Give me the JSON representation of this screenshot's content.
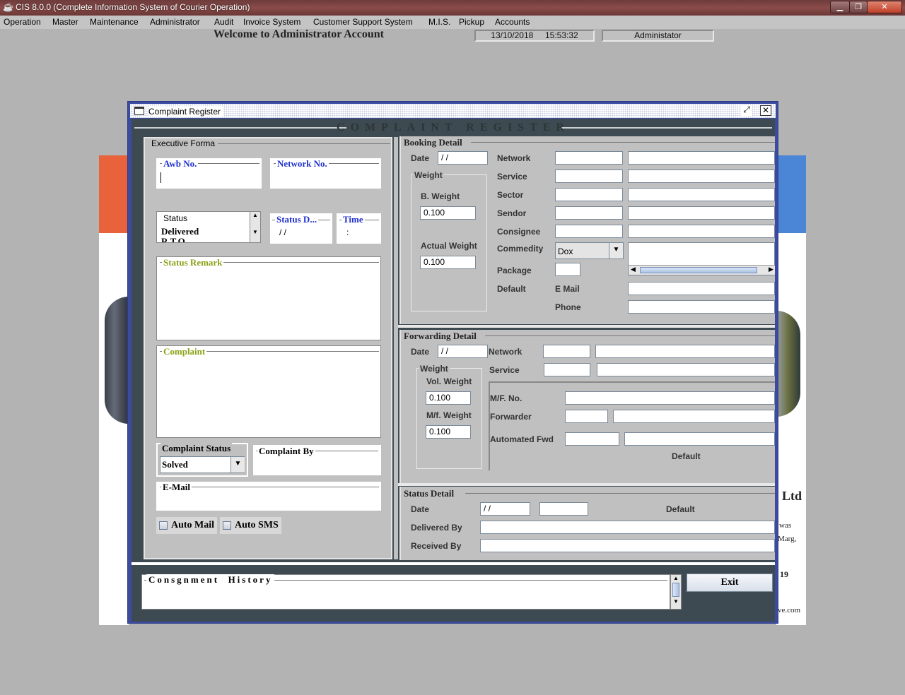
{
  "window": {
    "title": "CIS 8.0.0 (Complete Information System of Courier Operation)",
    "min_icon": "minimize-icon",
    "max_icon": "maximize-icon",
    "close_icon": "close-icon"
  },
  "menu": [
    "Operation",
    "Master",
    "Maintenance",
    "Administrator",
    "Audit",
    "Invoice System",
    "Customer Support System",
    "M.I.S.",
    "Pickup",
    "Accounts"
  ],
  "header": {
    "welcome": "Welcome to Administrator Account",
    "date": "13/10/2018",
    "time": "15:53:32",
    "user": "Administator"
  },
  "background": {
    "company_suffix": "Ltd",
    "addr1": "was",
    "addr2": "Marg,",
    "phone_frag": "19",
    "web_frag": "ve.com"
  },
  "frame": {
    "title": "Complaint Register",
    "heading": "COMPLAINT REGISTER",
    "exit_label": "Exit"
  },
  "left": {
    "executive_forma": "Executive Forma",
    "awb_label": "Awb No.",
    "network_label": "Network No.",
    "status_label": "Status",
    "status_value": "Delivered",
    "status_next": "R.T.O.",
    "status_date_label": "Status D...",
    "status_date_value": "/ /",
    "time_label": "Time",
    "time_value": ":",
    "status_remark_label": "Status Remark",
    "complaint_label": "Complaint",
    "complaint_status_label": "Complaint Status",
    "complaint_status_value": "Solved",
    "complaint_by_label": "Complaint By",
    "email_label": "E-Mail",
    "auto_mail": "Auto Mail",
    "auto_sms": "Auto SMS"
  },
  "booking": {
    "header": "Booking Detail",
    "date_label": "Date",
    "date_value": "/ /",
    "weight_label": "Weight",
    "b_weight_label": "B. Weight",
    "b_weight_value": "0.100",
    "actual_weight_label": "Actual Weight",
    "actual_weight_value": "0.100",
    "network_label": "Network",
    "service_label": "Service",
    "sector_label": "Sector",
    "sendor_label": "Sendor",
    "consignee_label": "Consignee",
    "commodity_label": "Commedity",
    "commodity_value": "Dox",
    "package_label": "Package",
    "default_label": "Default",
    "email_label": "E Mail",
    "phone_label": "Phone"
  },
  "forwarding": {
    "header": "Forwarding Detail",
    "date_label": "Date",
    "date_value": "/ /",
    "network_label": "Network",
    "service_label": "Service",
    "weight_label": "Weight",
    "vol_weight_label": "Vol. Weight",
    "vol_weight_value": "0.100",
    "mf_weight_label": "M/f. Weight",
    "mf_weight_value": "0.100",
    "mf_no_label": "M/F. No.",
    "forwarder_label": "Forwarder",
    "automated_fwd_label": "Automated Fwd",
    "default_label": "Default"
  },
  "status_detail": {
    "header": "Status Detail",
    "date_label": "Date",
    "date_value": "/ /",
    "default_label": "Default",
    "delivered_by_label": "Delivered By",
    "received_by_label": "Received By"
  },
  "history": {
    "label": "Consgnment  History"
  }
}
